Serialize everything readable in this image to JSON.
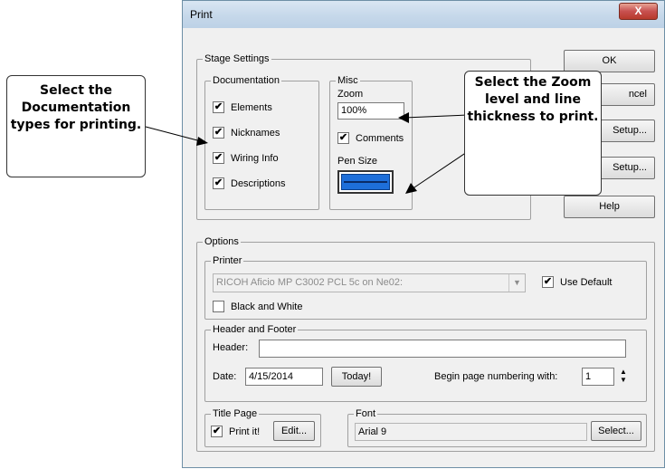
{
  "dialog": {
    "title": "Print",
    "close_glyph": "X",
    "stage_settings": {
      "label": "Stage Settings",
      "documentation": {
        "label": "Documentation",
        "items": [
          {
            "label": "Elements",
            "checked": true
          },
          {
            "label": "Nicknames",
            "checked": true
          },
          {
            "label": "Wiring Info",
            "checked": true
          },
          {
            "label": "Descriptions",
            "checked": true
          }
        ]
      },
      "misc": {
        "label": "Misc",
        "zoom_label": "Zoom",
        "zoom_value": "100%",
        "comments_label": "Comments",
        "comments_checked": true,
        "pen_size_label": "Pen Size"
      }
    },
    "buttons": {
      "ok": "OK",
      "cancel_visible": "ncel",
      "setup1_visible": "Setup...",
      "setup2_visible": "Setup...",
      "help": "Help"
    },
    "options": {
      "label": "Options",
      "printer": {
        "label": "Printer",
        "value": "RICOH Aficio MP C3002 PCL 5c on Ne02:",
        "use_default_label": "Use Default",
        "use_default_checked": true,
        "black_white_label": "Black and White",
        "black_white_checked": false
      },
      "header_footer": {
        "label": "Header and Footer",
        "header_label": "Header:",
        "header_value": "",
        "date_label": "Date:",
        "date_value": "4/15/2014",
        "today_button": "Today!",
        "begin_page_label": "Begin page numbering with:",
        "begin_page_value": "1"
      },
      "title_page": {
        "label": "Title Page",
        "print_it_label": "Print it!",
        "print_it_checked": true,
        "edit_button": "Edit..."
      },
      "font": {
        "label": "Font",
        "value": "Arial 9",
        "select_button": "Select..."
      }
    }
  },
  "callouts": {
    "documentation": "Select the Documentation types for printing.",
    "zoom": "Select the Zoom level and line thickness to print."
  },
  "colors": {
    "callout_border": "#333333",
    "close_button": "#c75050",
    "pen_color": "#1e6fd9"
  }
}
